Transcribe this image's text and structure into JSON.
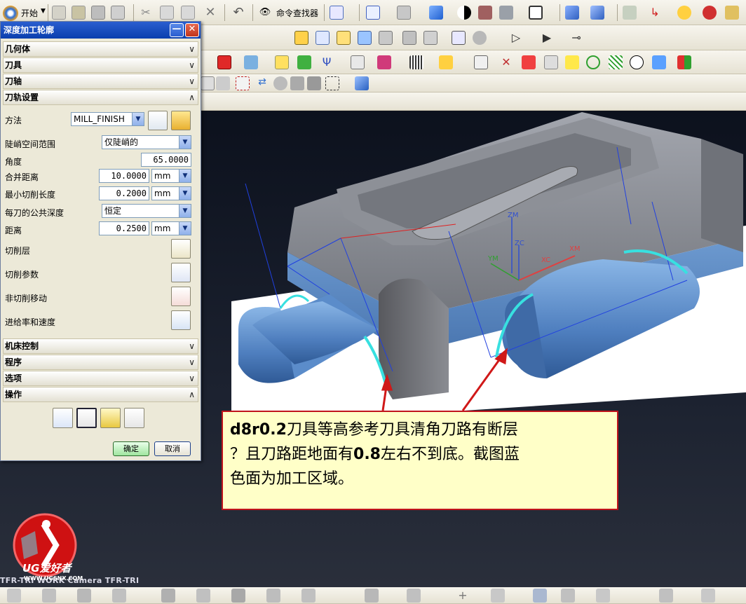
{
  "toolbar": {
    "start_label": "开始",
    "command_finder_label": "命令查找器"
  },
  "dialog": {
    "title": "深度加工轮廓",
    "sections": {
      "geometry": "几何体",
      "tool": "刀具",
      "tool_axis": "刀轴",
      "path_settings": "刀轨设置",
      "machine_control": "机床控制",
      "program": "程序",
      "options": "选项",
      "actions": "操作"
    },
    "fields": {
      "method_label": "方法",
      "method_value": "MILL_FINISH",
      "steep_label": "陡峭空间范围",
      "steep_value": "仅陡峭的",
      "angle_label": "角度",
      "angle_value": "65.0000",
      "merge_label": "合并距离",
      "merge_value": "10.0000",
      "merge_unit": "mm",
      "min_cut_label": "最小切削长度",
      "min_cut_value": "0.2000",
      "min_cut_unit": "mm",
      "depth_label": "每刀的公共深度",
      "depth_value": "恒定",
      "distance_label": "距离",
      "distance_value": "0.2500",
      "distance_unit": "mm",
      "cut_levels_label": "切削层",
      "cut_params_label": "切削参数",
      "non_cut_label": "非切削移动",
      "feeds_label": "进给率和速度"
    },
    "ok_label": "确定",
    "cancel_label": "取消"
  },
  "viewport": {
    "axis_labels": [
      "ZM",
      "ZC",
      "YM",
      "XM",
      "XC"
    ],
    "camera_label": "TFR-TRI WORK Camera TFR-TRI"
  },
  "note": {
    "line1_bold": "d8r0.2",
    "line1_rest": "刀具等高参考刀具清角刀路有断层",
    "line2_prefix": "？且刀路距地面有",
    "line2_bold": "0.8",
    "line2_rest": "左右不到底。截图蓝",
    "line3": "色面为加工区域。"
  },
  "watermark": {
    "text": "UG爱好者",
    "url": "WWW.UGSNX.COM"
  },
  "colors": {
    "note_border": "#c0141c",
    "part_blue": "#5a86c0",
    "part_gray": "#8c8f98",
    "title_bar": "#0a3fae"
  }
}
